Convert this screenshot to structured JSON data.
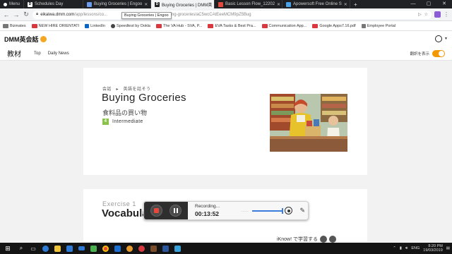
{
  "browser": {
    "tabs": [
      {
        "title": "Menu",
        "icon": "dot-icon",
        "color": "#ffffff"
      },
      {
        "title": "Schedules Day",
        "icon": "d-icon",
        "color": "#ffffff"
      },
      {
        "title": "Buying Groceries | Engoo",
        "icon": "engoo-icon",
        "color": "#6a9cf0"
      },
      {
        "title": "Buying Groceries | DMM英",
        "icon": "d-icon",
        "color": "#ffffff",
        "active": true
      },
      {
        "title": "Basic Lesson Flow_12202",
        "icon": "pdf-icon",
        "color": "#e34a3d"
      },
      {
        "title": "Apowersoft Free Online S",
        "icon": "apowersoft-icon",
        "color": "#4aa3e8"
      }
    ],
    "tab_fav_letters": {
      "d": "D",
      "pdf": "PDF"
    },
    "new_tab": "+",
    "window_controls": {
      "minimize": "—",
      "maximize": "▢",
      "close": "✕"
    },
    "tooltip": "Buying Groceries | Engoo",
    "url_host": "eikaiwa.dmm.com",
    "url_path": "/app/lessons/co...",
    "url_tail": "...ying-buying-groceries/aC5wcCAtEeeMCM9pZ5Bug",
    "nav": {
      "back": "←",
      "forward": "→",
      "reload": "↻"
    }
  },
  "bookmarks": [
    {
      "label": "Bizmates",
      "color": "#777777"
    },
    {
      "label": "NEW HIRE ORIENTATI",
      "color": "#d9393e"
    },
    {
      "label": "LinkedIn",
      "color": "#0a66c2"
    },
    {
      "label": "Speedtest by Ookla",
      "color": "#444444"
    },
    {
      "label": "The VA Hub - SVA, P...",
      "color": "#d9393e"
    },
    {
      "label": "EVA Tasks & Best Pra...",
      "color": "#d9393e"
    },
    {
      "label": "Communication App...",
      "color": "#d9393e"
    },
    {
      "label": "Google Apps7.16.pdf",
      "color": "#d9393e"
    },
    {
      "label": "Employee Portal",
      "color": "#777777"
    }
  ],
  "site": {
    "logo": "DMM英会話",
    "page_title": "教材",
    "nav_links": [
      "Top",
      "Daily News"
    ],
    "translation_toggle_label": "翻訳を表示",
    "translation_toggle_on": true,
    "accent": "#f39800"
  },
  "lesson": {
    "breadcrumb": "会話　▸　英語を話そう",
    "title": "Buying Groceries",
    "title_jp": "食料品の買い物",
    "level_number": "4",
    "level_label": "Intermediate",
    "level_color": "#8bc34a"
  },
  "exercise": {
    "label": "Exercise 1",
    "title": "Vocabulary",
    "iknow_text": "iKnow! で学習する"
  },
  "recorder": {
    "status": "Recording...",
    "time": "00:13:52",
    "stop_color": "#e8483b",
    "volume_color": "#3b7ddd"
  },
  "taskbar": {
    "apps": [
      {
        "name": "search-icon",
        "color": "#ffffff"
      },
      {
        "name": "task-view-icon",
        "color": "#ffffff"
      },
      {
        "name": "edge-icon",
        "color": "#2d7bd6"
      },
      {
        "name": "file-explorer-icon",
        "color": "#f0c43a"
      },
      {
        "name": "store-icon",
        "color": "#2d7bd6"
      },
      {
        "name": "mail-icon",
        "color": "#2d7bd6"
      },
      {
        "name": "video-icon",
        "color": "#4caf50"
      },
      {
        "name": "chrome-icon",
        "color": "#e8453c"
      },
      {
        "name": "outlook-icon",
        "color": "#1c6fd1"
      },
      {
        "name": "app-icon",
        "color": "#e89b2d"
      },
      {
        "name": "recorder-icon",
        "color": "#d9393e"
      },
      {
        "name": "photo-icon",
        "color": "#7a4d2d"
      },
      {
        "name": "word-icon",
        "color": "#2b579a"
      },
      {
        "name": "app2-icon",
        "color": "#3aa0d8"
      }
    ],
    "lang": "ENG",
    "time": "8:20 PM",
    "date": "19/03/2019"
  }
}
